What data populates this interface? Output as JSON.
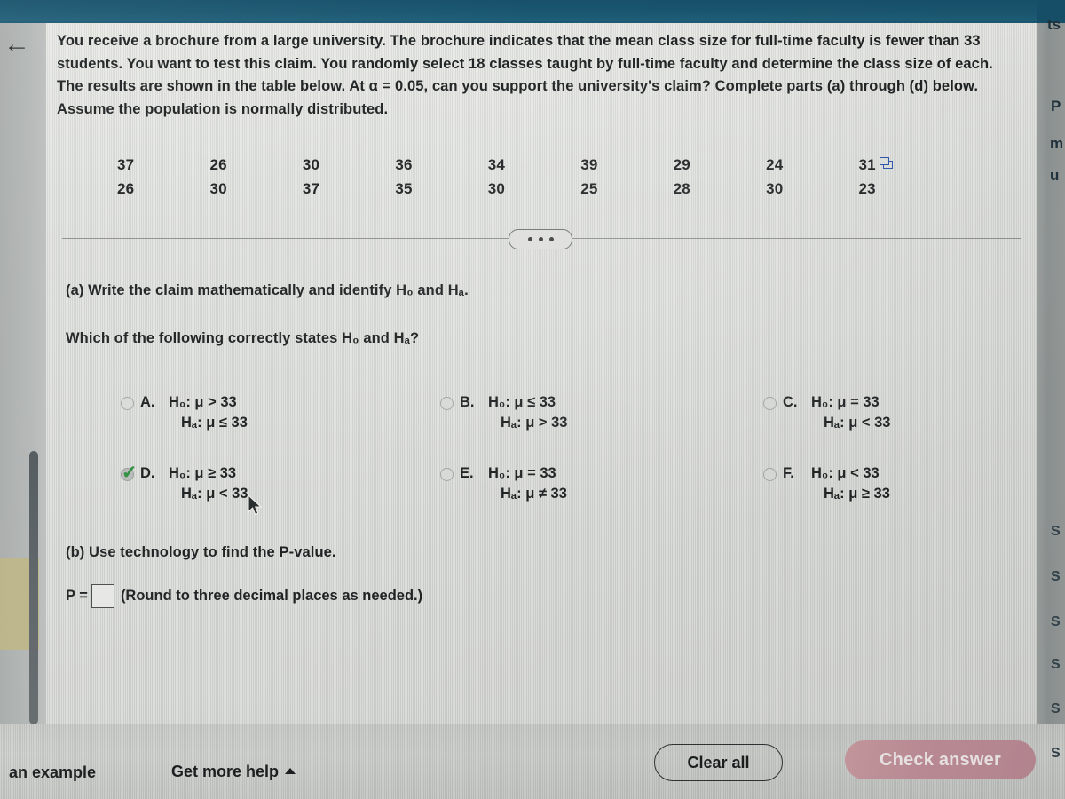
{
  "topbar": {
    "color": "#17506b"
  },
  "nav": {
    "back_icon": "back-arrow-icon"
  },
  "problem": {
    "stem": "You receive a brochure from a large university. The brochure indicates that the mean class size for full-time faculty is fewer than 33 students. You want to test this claim. You randomly select 18 classes taught by full-time faculty and determine the class size of each. The results are shown in the table below. At α = 0.05, can you support the university's claim? Complete parts (a) through (d) below. Assume the population is normally distributed.",
    "data_table": {
      "rows": [
        [
          "37",
          "26",
          "30",
          "36",
          "34",
          "39",
          "29",
          "24",
          "31"
        ],
        [
          "26",
          "30",
          "37",
          "35",
          "30",
          "25",
          "28",
          "30",
          "23"
        ]
      ],
      "popout_icon": "open-in-spreadsheet-icon"
    },
    "divider_icon": "more-options-ellipsis"
  },
  "part_a": {
    "prompt": "(a) Write the claim mathematically and identify H₀ and Hₐ.",
    "question": "Which of the following correctly states H₀ and Hₐ?",
    "options": [
      {
        "letter": "A.",
        "h0": "H₀: μ > 33",
        "ha": "Hₐ: μ ≤ 33",
        "selected": false
      },
      {
        "letter": "B.",
        "h0": "H₀: μ ≤ 33",
        "ha": "Hₐ: μ > 33",
        "selected": false
      },
      {
        "letter": "C.",
        "h0": "H₀: μ = 33",
        "ha": "Hₐ: μ < 33",
        "selected": false
      },
      {
        "letter": "D.",
        "h0": "H₀: μ ≥ 33",
        "ha": "Hₐ: μ < 33",
        "selected": true
      },
      {
        "letter": "E.",
        "h0": "H₀: μ = 33",
        "ha": "Hₐ: μ ≠ 33",
        "selected": false
      },
      {
        "letter": "F.",
        "h0": "H₀: μ < 33",
        "ha": "Hₐ: μ ≥ 33",
        "selected": false
      }
    ],
    "selected_letter": "D.",
    "check_icon": "green-check-icon",
    "accent_correct": "#2f8f3e"
  },
  "part_b": {
    "prompt": "(b) Use technology to find the P-value.",
    "p_label": "P =",
    "p_value": "",
    "p_placeholder": "",
    "hint": "(Round to three decimal places as needed.)"
  },
  "footer": {
    "example_link": "an example",
    "help_link": "Get more help",
    "help_caret_icon": "caret-up-icon",
    "clear_button": "Clear all",
    "check_button": "Check answer",
    "check_button_color": "#c08f99"
  },
  "edge_fragments": {
    "right": [
      "ts",
      "P",
      "m",
      "u"
    ],
    "right_list": [
      "S",
      "S",
      "S",
      "S",
      "S",
      "S"
    ]
  },
  "cursor": {
    "icon": "mouse-pointer-icon"
  }
}
